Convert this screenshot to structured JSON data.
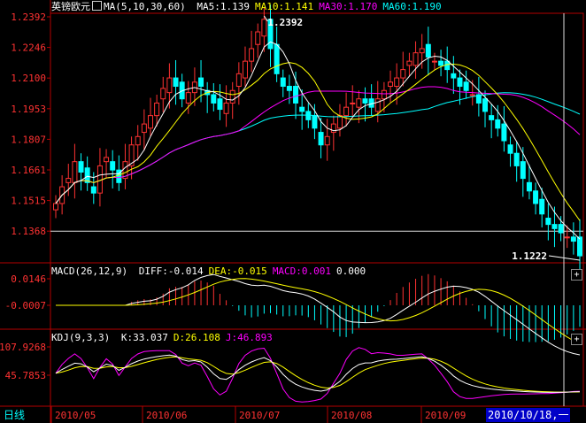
{
  "instrument_name": "英镑欧元",
  "price_panel": {
    "indicator": "MA(5,10,30,60)",
    "items": [
      {
        "label": "MA5:",
        "value": "1.139",
        "color": "#ffffff"
      },
      {
        "label": "MA10:",
        "value": "1.141",
        "color": "#ffff00"
      },
      {
        "label": "MA30:",
        "value": "1.170",
        "color": "#ff00ff"
      },
      {
        "label": "MA60:",
        "value": "1.190",
        "color": "#00ffff"
      }
    ],
    "y_ticks": [
      "1.2392",
      "1.2246",
      "1.2100",
      "1.1953",
      "1.1807",
      "1.1661",
      "1.1515",
      "1.1368"
    ],
    "max_label": "1.2392",
    "min_label": "1.1222"
  },
  "macd_panel": {
    "indicator": "MACD(26,12,9)",
    "items": [
      {
        "label": "DIFF:",
        "value": "-0.014",
        "color": "#ffffff"
      },
      {
        "label": "DEA:",
        "value": "-0.015",
        "color": "#ffff00"
      },
      {
        "label": "MACD:",
        "value": "0.001",
        "color": "#ff00ff"
      },
      {
        "label": "",
        "value": "0.000",
        "color": "#ffffff"
      }
    ],
    "y_ticks": [
      "0.0146",
      "-0.0007"
    ]
  },
  "kdj_panel": {
    "indicator": "KDJ(9,3,3)",
    "items": [
      {
        "label": "K:",
        "value": "33.037",
        "color": "#ffffff"
      },
      {
        "label": "D:",
        "value": "26.108",
        "color": "#ffff00"
      },
      {
        "label": "J:",
        "value": "46.893",
        "color": "#ff00ff"
      }
    ],
    "y_ticks": [
      "107.9268",
      "45.7853"
    ]
  },
  "x_axis_labels": [
    "2010/05",
    "2010/06",
    "2010/07",
    "2010/08",
    "2010/09"
  ],
  "period_tab": "日线",
  "cursor_date": "2010/10/18,一",
  "colors": {
    "up": "#ff3232",
    "down": "#00ffff",
    "ma5": "#ffffff",
    "ma10": "#ffff00",
    "ma30": "#ff00ff",
    "ma60": "#00ffff",
    "frame": "#b40000",
    "text": "#ffffff"
  },
  "chart_data": [
    {
      "type": "candlestick",
      "title": "英镑欧元",
      "ylim": [
        1.1222,
        1.2392
      ],
      "x_start": "2010/05",
      "x_end": "2010/10/18",
      "close_approx": [
        1.15,
        1.158,
        1.162,
        1.17,
        1.165,
        1.16,
        1.155,
        1.168,
        1.172,
        1.166,
        1.16,
        1.17,
        1.178,
        1.182,
        1.188,
        1.192,
        1.198,
        1.205,
        1.21,
        1.206,
        1.2,
        1.203,
        1.208,
        1.206,
        1.202,
        1.198,
        1.195,
        1.198,
        1.204,
        1.212,
        1.218,
        1.224,
        1.232,
        1.238,
        1.224,
        1.212,
        1.206,
        1.204,
        1.198,
        1.194,
        1.19,
        1.186,
        1.178,
        1.182,
        1.188,
        1.192,
        1.196,
        1.198,
        1.2,
        1.198,
        1.196,
        1.2,
        1.204,
        1.208,
        1.21,
        1.214,
        1.218,
        1.222,
        1.224,
        1.22,
        1.218,
        1.216,
        1.214,
        1.21,
        1.206,
        1.204,
        1.202,
        1.198,
        1.194,
        1.19,
        1.186,
        1.18,
        1.174,
        1.168,
        1.162,
        1.156,
        1.15,
        1.145,
        1.14,
        1.138,
        1.136,
        1.134,
        1.132,
        1.125
      ],
      "max": 1.2392,
      "min": 1.1222,
      "ma_last": {
        "MA5": 1.139,
        "MA10": 1.141,
        "MA30": 1.17,
        "MA60": 1.19
      }
    },
    {
      "type": "bar",
      "title": "MACD(26,12,9)",
      "series": [
        {
          "name": "DIFF",
          "last": -0.014
        },
        {
          "name": "DEA",
          "last": -0.015
        },
        {
          "name": "MACD",
          "last": 0.001
        }
      ],
      "ylim": [
        -0.0007,
        0.0146
      ]
    },
    {
      "type": "line",
      "title": "KDJ(9,3,3)",
      "series": [
        {
          "name": "K",
          "last": 33.037
        },
        {
          "name": "D",
          "last": 26.108
        },
        {
          "name": "J",
          "last": 46.893
        }
      ],
      "ylim": [
        45.7853,
        107.9268
      ]
    }
  ]
}
